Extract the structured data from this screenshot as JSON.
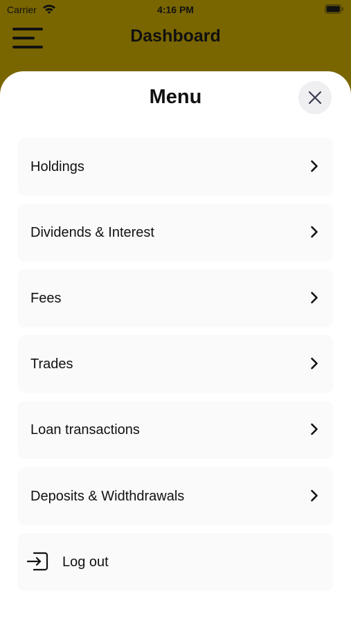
{
  "status_bar": {
    "carrier": "Carrier",
    "time": "4:16 PM",
    "icons": [
      "wifi-icon",
      "battery-icon"
    ]
  },
  "header": {
    "title": "Dashboard",
    "menu_icon": "hamburger-icon",
    "background_color": "#7a6600"
  },
  "menu": {
    "title": "Menu",
    "close_icon": "close-icon",
    "items": [
      {
        "label": "Holdings",
        "icon": "chevron-right-icon"
      },
      {
        "label": "Dividends & Interest",
        "icon": "chevron-right-icon"
      },
      {
        "label": "Fees",
        "icon": "chevron-right-icon"
      },
      {
        "label": "Trades",
        "icon": "chevron-right-icon"
      },
      {
        "label": "Loan transactions",
        "icon": "chevron-right-icon"
      },
      {
        "label": "Deposits & Widthdrawals",
        "icon": "chevron-right-icon"
      }
    ],
    "logout": {
      "label": "Log out",
      "icon": "logout-icon"
    }
  }
}
